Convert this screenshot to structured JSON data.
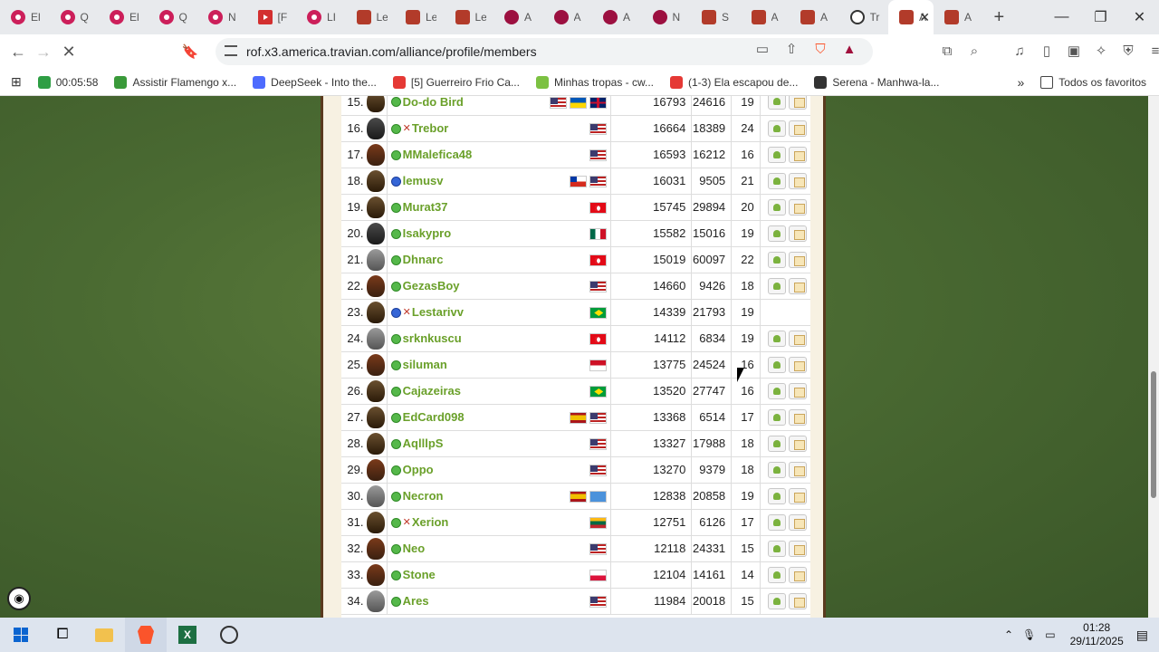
{
  "tabs": [
    {
      "label": "El",
      "icon": "youtube-icon"
    },
    {
      "label": "Q",
      "icon": "youtube-icon"
    },
    {
      "label": "El",
      "icon": "youtube-icon"
    },
    {
      "label": "Q",
      "icon": "youtube-icon"
    },
    {
      "label": "N",
      "icon": "youtube-icon"
    },
    {
      "label": "[F",
      "icon": "youtube-icon"
    },
    {
      "label": "LI",
      "icon": "youtube-icon"
    },
    {
      "label": "Le",
      "icon": "travian-icon"
    },
    {
      "label": "Le",
      "icon": "travian-icon"
    },
    {
      "label": "Le",
      "icon": "travian-icon"
    },
    {
      "label": "A",
      "icon": "app-icon"
    },
    {
      "label": "A",
      "icon": "app-icon"
    },
    {
      "label": "A",
      "icon": "app-icon"
    },
    {
      "label": "N",
      "icon": "app-icon"
    },
    {
      "label": "S",
      "icon": "travian-icon"
    },
    {
      "label": "A",
      "icon": "travian-icon"
    },
    {
      "label": "A",
      "icon": "travian-icon"
    },
    {
      "label": "Tr",
      "icon": "chatgpt-icon"
    },
    {
      "label": "A",
      "icon": "travian-icon",
      "active": true
    },
    {
      "label": "A",
      "icon": "travian-icon"
    }
  ],
  "address": {
    "url": "rof.x3.america.travian.com/alliance/profile/members"
  },
  "bookmarks": [
    {
      "label": "00:05:58",
      "color": "#2e9e44"
    },
    {
      "label": "Assistir Flamengo x...",
      "color": "#3a9a3a"
    },
    {
      "label": "DeepSeek - Into the...",
      "color": "#4d6bfe"
    },
    {
      "label": "[5] Guerreiro Frio Ca...",
      "color": "#e53935"
    },
    {
      "label": "Minhas tropas - cw...",
      "color": "#7cc142"
    },
    {
      "label": "(1-3) Ela escapou de...",
      "color": "#e53935"
    },
    {
      "label": "Serena - Manhwa-la...",
      "color": "#333333"
    }
  ],
  "all_favorites": "Todos os favoritos",
  "members": [
    {
      "rank": "15.",
      "tribe": "teuton",
      "status": "green",
      "war": false,
      "name": "Do-do Bird",
      "flags": [
        "us",
        "ua",
        "gb"
      ],
      "pop": "16793",
      "n1": "24616",
      "villages": "19",
      "actions": true
    },
    {
      "rank": "16.",
      "tribe": "gaul",
      "status": "green",
      "war": true,
      "name": "Trebor",
      "flags": [
        "us"
      ],
      "pop": "16664",
      "n1": "18389",
      "villages": "24",
      "actions": true
    },
    {
      "rank": "17.",
      "tribe": "rome",
      "status": "green",
      "war": false,
      "name": "MMalefica48",
      "flags": [
        "us"
      ],
      "pop": "16593",
      "n1": "16212",
      "villages": "16",
      "actions": true
    },
    {
      "rank": "18.",
      "tribe": "teuton",
      "status": "blue",
      "war": false,
      "name": "lemusv",
      "flags": [
        "cl",
        "us"
      ],
      "pop": "16031",
      "n1": "9505",
      "villages": "21",
      "actions": true
    },
    {
      "rank": "19.",
      "tribe": "teuton",
      "status": "green",
      "war": false,
      "name": "Murat37",
      "flags": [
        "tr"
      ],
      "pop": "15745",
      "n1": "29894",
      "villages": "20",
      "actions": true
    },
    {
      "rank": "20.",
      "tribe": "gaul",
      "status": "green",
      "war": false,
      "name": "Isakypro",
      "flags": [
        "mx"
      ],
      "pop": "15582",
      "n1": "15016",
      "villages": "19",
      "actions": true
    },
    {
      "rank": "21.",
      "tribe": "natar",
      "status": "green",
      "war": false,
      "name": "Dhnarc",
      "flags": [
        "tr"
      ],
      "pop": "15019",
      "n1": "60097",
      "villages": "22",
      "actions": true
    },
    {
      "rank": "22.",
      "tribe": "rome",
      "status": "green",
      "war": false,
      "name": "GezasBoy",
      "flags": [
        "us"
      ],
      "pop": "14660",
      "n1": "9426",
      "villages": "18",
      "actions": true
    },
    {
      "rank": "23.",
      "tribe": "teuton",
      "status": "blue",
      "war": true,
      "name": "Lestarivv",
      "flags": [
        "br"
      ],
      "pop": "14339",
      "n1": "21793",
      "villages": "19",
      "actions": false
    },
    {
      "rank": "24.",
      "tribe": "natar",
      "status": "green",
      "war": false,
      "name": "srknkuscu",
      "flags": [
        "tr"
      ],
      "pop": "14112",
      "n1": "6834",
      "villages": "19",
      "actions": true
    },
    {
      "rank": "25.",
      "tribe": "rome",
      "status": "green",
      "war": false,
      "name": "siluman",
      "flags": [
        "id"
      ],
      "pop": "13775",
      "n1": "24524",
      "villages": "16",
      "actions": true
    },
    {
      "rank": "26.",
      "tribe": "teuton",
      "status": "green",
      "war": false,
      "name": "Cajazeiras",
      "flags": [
        "br"
      ],
      "pop": "13520",
      "n1": "27747",
      "villages": "16",
      "actions": true
    },
    {
      "rank": "27.",
      "tribe": "teuton",
      "status": "green",
      "war": false,
      "name": "EdCard098",
      "flags": [
        "es",
        "us"
      ],
      "pop": "13368",
      "n1": "6514",
      "villages": "17",
      "actions": true
    },
    {
      "rank": "28.",
      "tribe": "teuton",
      "status": "green",
      "war": false,
      "name": "AqlllpS",
      "flags": [
        "us"
      ],
      "pop": "13327",
      "n1": "17988",
      "villages": "18",
      "actions": true
    },
    {
      "rank": "29.",
      "tribe": "rome",
      "status": "green",
      "war": false,
      "name": "Oppo",
      "flags": [
        "us"
      ],
      "pop": "13270",
      "n1": "9379",
      "villages": "18",
      "actions": true
    },
    {
      "rank": "30.",
      "tribe": "natar",
      "status": "green",
      "war": false,
      "name": "Necron",
      "flags": [
        "es",
        "un"
      ],
      "pop": "12838",
      "n1": "20858",
      "villages": "19",
      "actions": true
    },
    {
      "rank": "31.",
      "tribe": "teuton",
      "status": "green",
      "war": true,
      "name": "Xerion",
      "flags": [
        "lt"
      ],
      "pop": "12751",
      "n1": "6126",
      "villages": "17",
      "actions": true
    },
    {
      "rank": "32.",
      "tribe": "rome",
      "status": "green",
      "war": false,
      "name": "Neo",
      "flags": [
        "us"
      ],
      "pop": "12118",
      "n1": "24331",
      "villages": "15",
      "actions": true
    },
    {
      "rank": "33.",
      "tribe": "rome",
      "status": "green",
      "war": false,
      "name": "Stone",
      "flags": [
        "pl"
      ],
      "pop": "12104",
      "n1": "14161",
      "villages": "14",
      "actions": true
    },
    {
      "rank": "34.",
      "tribe": "natar",
      "status": "green",
      "war": false,
      "name": "Ares",
      "flags": [
        "us"
      ],
      "pop": "11984",
      "n1": "20018",
      "villages": "15",
      "actions": true
    }
  ],
  "clock": {
    "time": "01:28",
    "date": "29/11/2025"
  }
}
